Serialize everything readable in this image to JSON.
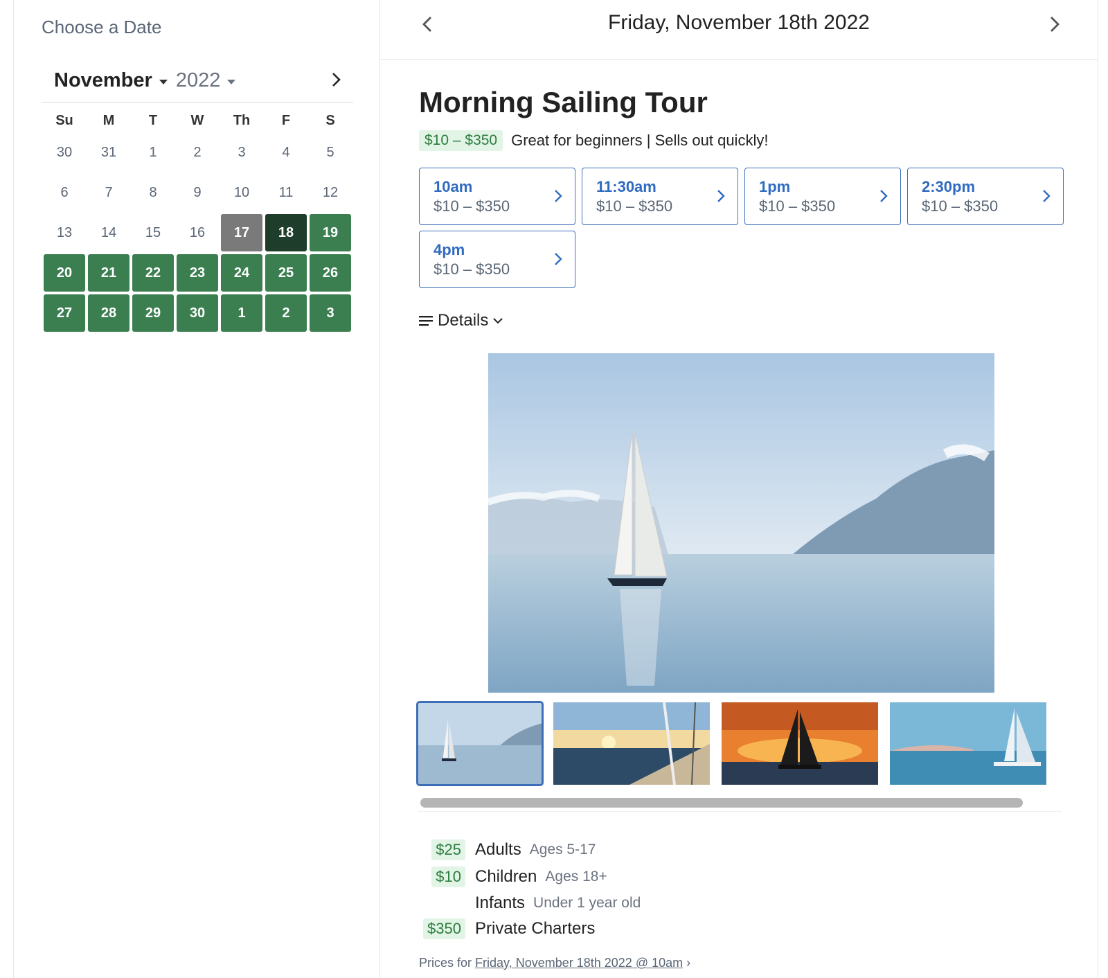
{
  "left_panel": {
    "title": "Choose a Date",
    "month": "November",
    "year": "2022"
  },
  "calendar": {
    "weekdays": [
      "Su",
      "M",
      "T",
      "W",
      "Th",
      "F",
      "S"
    ],
    "days": [
      {
        "d": "30",
        "state": "muted"
      },
      {
        "d": "31",
        "state": "muted"
      },
      {
        "d": "1",
        "state": "muted"
      },
      {
        "d": "2",
        "state": "muted"
      },
      {
        "d": "3",
        "state": "muted"
      },
      {
        "d": "4",
        "state": "muted"
      },
      {
        "d": "5",
        "state": "muted"
      },
      {
        "d": "6",
        "state": "muted"
      },
      {
        "d": "7",
        "state": "muted"
      },
      {
        "d": "8",
        "state": "muted"
      },
      {
        "d": "9",
        "state": "muted"
      },
      {
        "d": "10",
        "state": "muted"
      },
      {
        "d": "11",
        "state": "muted"
      },
      {
        "d": "12",
        "state": "muted"
      },
      {
        "d": "13",
        "state": "muted"
      },
      {
        "d": "14",
        "state": "muted"
      },
      {
        "d": "15",
        "state": "muted"
      },
      {
        "d": "16",
        "state": "muted"
      },
      {
        "d": "17",
        "state": "today"
      },
      {
        "d": "18",
        "state": "selected"
      },
      {
        "d": "19",
        "state": "avail"
      },
      {
        "d": "20",
        "state": "avail"
      },
      {
        "d": "21",
        "state": "avail"
      },
      {
        "d": "22",
        "state": "avail"
      },
      {
        "d": "23",
        "state": "avail"
      },
      {
        "d": "24",
        "state": "avail"
      },
      {
        "d": "25",
        "state": "avail"
      },
      {
        "d": "26",
        "state": "avail"
      },
      {
        "d": "27",
        "state": "avail"
      },
      {
        "d": "28",
        "state": "avail"
      },
      {
        "d": "29",
        "state": "avail"
      },
      {
        "d": "30",
        "state": "avail"
      },
      {
        "d": "1",
        "state": "avail"
      },
      {
        "d": "2",
        "state": "avail"
      },
      {
        "d": "3",
        "state": "avail"
      }
    ]
  },
  "header": {
    "date": "Friday, November 18th 2022"
  },
  "tour": {
    "title": "Morning Sailing Tour",
    "price_range": "$10 – $350",
    "tagline": "Great for beginners | Sells out quickly!",
    "details_label": "Details"
  },
  "slots": [
    {
      "time": "10am",
      "price": "$10 – $350"
    },
    {
      "time": "11:30am",
      "price": "$10 – $350"
    },
    {
      "time": "1pm",
      "price": "$10 – $350"
    },
    {
      "time": "2:30pm",
      "price": "$10 – $350"
    },
    {
      "time": "4pm",
      "price": "$10 – $350"
    }
  ],
  "gallery": {
    "images": [
      "sailboat-calm-lake",
      "sunset-from-deck",
      "catamaran-orange-sunset",
      "sailboat-blue-sky"
    ],
    "active_index": 0
  },
  "prices": [
    {
      "amount": "$25",
      "label": "Adults",
      "note": "Ages 5-17"
    },
    {
      "amount": "$10",
      "label": "Children",
      "note": "Ages 18+"
    },
    {
      "amount": "",
      "label": "Infants",
      "note": "Under 1 year old"
    },
    {
      "amount": "$350",
      "label": "Private Charters",
      "note": ""
    }
  ],
  "prices_for": {
    "prefix": "Prices for ",
    "link": "Friday, November 18th 2022 @ 10am",
    "suffix": " ›"
  },
  "colors": {
    "available": "#3b7f51",
    "selected": "#1e3d2a",
    "today": "#7a7a7a",
    "accent_blue": "#2f6bc1",
    "price_bg": "#e2f4e6",
    "price_text": "#2e7d3f"
  }
}
